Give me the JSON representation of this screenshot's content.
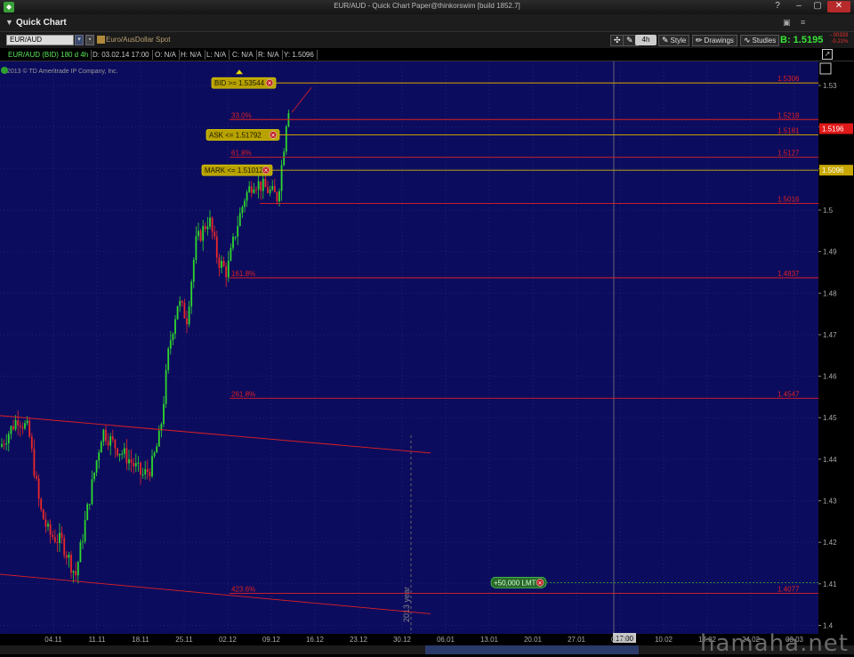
{
  "window": {
    "title": "EUR/AUD - Quick Chart Paper@thinkorswim [build 1852.7]"
  },
  "panel": {
    "title": "Quick Chart"
  },
  "toolbar": {
    "symbol": "EUR/AUD",
    "description": "Euro/AusDollar Spot",
    "interval": "4h",
    "style_label": "Style",
    "drawings_label": "Drawings",
    "studies_label": "Studies",
    "bid_price": "B: 1.5195",
    "net_change": "-.00333",
    "net_change_pct": "-0.21%"
  },
  "infobar": {
    "symbol": "EUR/AUD (BID) 180 d 4h",
    "date": "D: 03.02.14 17:00",
    "open": "O: N/A",
    "high": "H: N/A",
    "low": "L: N/A",
    "close": "C: N/A",
    "range": "R: N/A",
    "y": "Y: 1.5096"
  },
  "chart": {
    "copyright": "2013 © TD Ameritrade IP Company, Inc.",
    "colors": {
      "background": "#0c0c5e",
      "up": "#2ed82e",
      "down": "#e82828",
      "level": "#e02020",
      "order": "#c8b400"
    },
    "y_ticks": [
      "1.53",
      "1.52",
      "1.51",
      "1.5",
      "1.49",
      "1.48",
      "1.47",
      "1.46",
      "1.45",
      "1.44",
      "1.43",
      "1.42",
      "1.41",
      "1.4"
    ],
    "x_ticks": [
      "04.11",
      "11.11",
      "18.11",
      "25.11",
      "02.12",
      "09.12",
      "16.12",
      "23.12",
      "30.12",
      "06.01",
      "13.01",
      "20.01",
      "27.01",
      "03.02",
      "10.02",
      "17.02",
      "24.02",
      "03.03"
    ],
    "year_label": "2013 year",
    "cursor_time": "17:00",
    "fib_levels": [
      {
        "label": "",
        "value": 1.5306,
        "price": "1.5306"
      },
      {
        "label": "33.0%",
        "value": 1.5218,
        "price": "1.5218"
      },
      {
        "label": "",
        "value": 1.5181,
        "price": "1.5181"
      },
      {
        "label": "61.8%",
        "value": 1.5127,
        "price": "1.5127"
      },
      {
        "label": "",
        "value": 1.5016,
        "price": "1.5016"
      },
      {
        "label": "161.8%",
        "value": 1.4837,
        "price": "1.4837"
      },
      {
        "label": "261.8%",
        "value": 1.4547,
        "price": "1.4547"
      },
      {
        "label": "423.6%",
        "value": 1.4077,
        "price": "1.4077"
      }
    ],
    "orders": [
      {
        "label": "BID >= 1.53544",
        "value": 1.5306
      },
      {
        "label": "ASK <= 1.51792",
        "value": 1.5181
      },
      {
        "label": "MARK <= 1.51012",
        "value": 1.5096
      },
      {
        "label": "+50,000 LMT",
        "value": 1.4103
      }
    ],
    "current_bid_label": "1.5196",
    "mark_label": "1.5096"
  },
  "watermark": "hamaha.net"
}
